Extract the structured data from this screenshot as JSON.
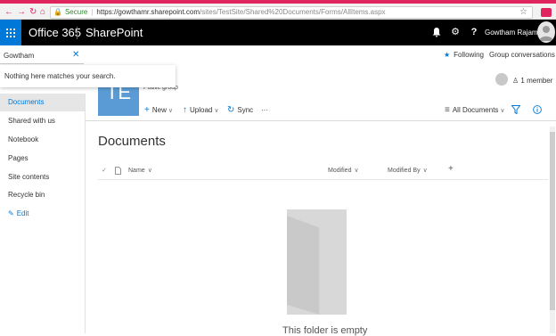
{
  "browser": {
    "secure_label": "Secure",
    "url_host": "https://gowthamr.sharepoint.com",
    "url_path": "/sites/TestSite/Shared%20Documents/Forms/AllItems.aspx"
  },
  "suite": {
    "app_launcher": "Office 365",
    "title": "SharePoint",
    "user_name": "Gowtham Rajama...",
    "icons": [
      "bell-icon",
      "gear-icon",
      "help-icon"
    ]
  },
  "search": {
    "value": "Gowtham",
    "no_results": "Nothing here matches your search."
  },
  "nav": {
    "items": [
      {
        "label": "Documents",
        "selected": true
      },
      {
        "label": "Shared with us"
      },
      {
        "label": "Notebook"
      },
      {
        "label": "Pages"
      },
      {
        "label": "Site contents"
      },
      {
        "label": "Recycle bin"
      }
    ],
    "edit": "Edit"
  },
  "site": {
    "logo_text": "TE",
    "group_type": "Public group",
    "following": "Following",
    "group_conversations": "Group conversations",
    "members": "1 member"
  },
  "commands": {
    "new": "New",
    "upload": "Upload",
    "sync": "Sync",
    "more": "···",
    "view": "All Documents"
  },
  "library": {
    "title": "Documents",
    "columns": {
      "name": "Name",
      "modified": "Modified",
      "modified_by": "Modified By"
    },
    "empty": "This folder is empty"
  },
  "colors": {
    "accent": "#0078d7",
    "suite": "#000000",
    "chrome": "#e0245e"
  }
}
